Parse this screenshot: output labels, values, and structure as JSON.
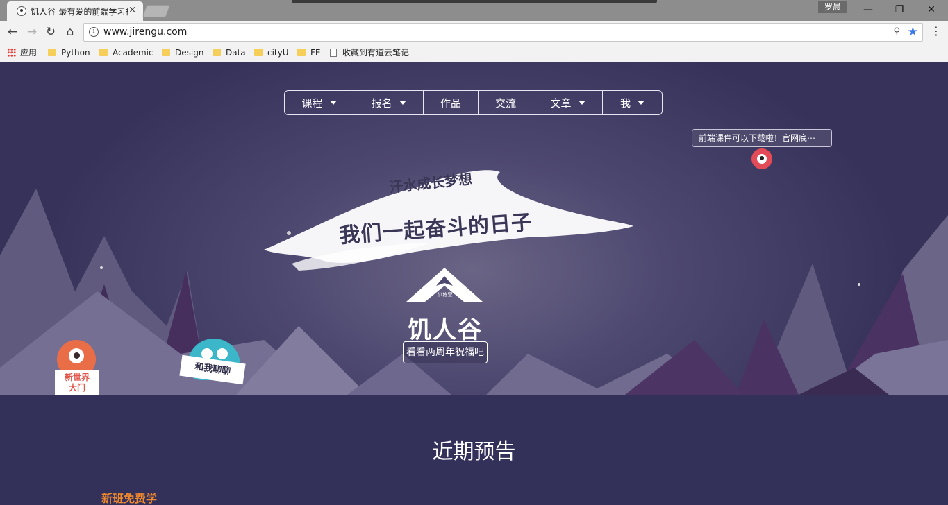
{
  "browser": {
    "tab_title": "饥人谷-最有爱的前端学习社区",
    "tab_close": "×",
    "user_name": "罗晨",
    "minimize": "—",
    "maximize": "❐",
    "close": "✕",
    "url": "www.jirengu.com",
    "bookmarks": [
      {
        "label": "应用",
        "icon": "apps-icon"
      },
      {
        "label": "Python",
        "icon": "folder-icon"
      },
      {
        "label": "Academic",
        "icon": "folder-icon"
      },
      {
        "label": "Design",
        "icon": "folder-icon"
      },
      {
        "label": "Data",
        "icon": "folder-icon"
      },
      {
        "label": "cityU",
        "icon": "folder-icon"
      },
      {
        "label": "FE",
        "icon": "folder-icon"
      },
      {
        "label": "收藏到有道云笔记",
        "icon": "page-icon"
      }
    ]
  },
  "nav": {
    "items": [
      {
        "label": "课程",
        "dropdown": true
      },
      {
        "label": "报名",
        "dropdown": true
      },
      {
        "label": "作品",
        "dropdown": false
      },
      {
        "label": "交流",
        "dropdown": false
      },
      {
        "label": "文章",
        "dropdown": true
      },
      {
        "label": "我",
        "dropdown": true
      }
    ]
  },
  "hero": {
    "notice": "前端课件可以下载啦！官网底⋯",
    "slogan_line1": "汗水成长梦想",
    "slogan_line2": "我们一起奋斗的日子",
    "logo_text": "饥人谷",
    "logo_small": "训练营",
    "anniversary_button": "看看两周年祝福吧",
    "left_sign": "新世界\n大门",
    "right_sign": "和我聊聊"
  },
  "section": {
    "title": "近期预告",
    "subheading": "新班免费学"
  },
  "colors": {
    "page_bg": "#33305a",
    "accent_orange": "#f2892c",
    "monster_red": "#e24b57",
    "monster_teal": "#3cb6c9"
  }
}
